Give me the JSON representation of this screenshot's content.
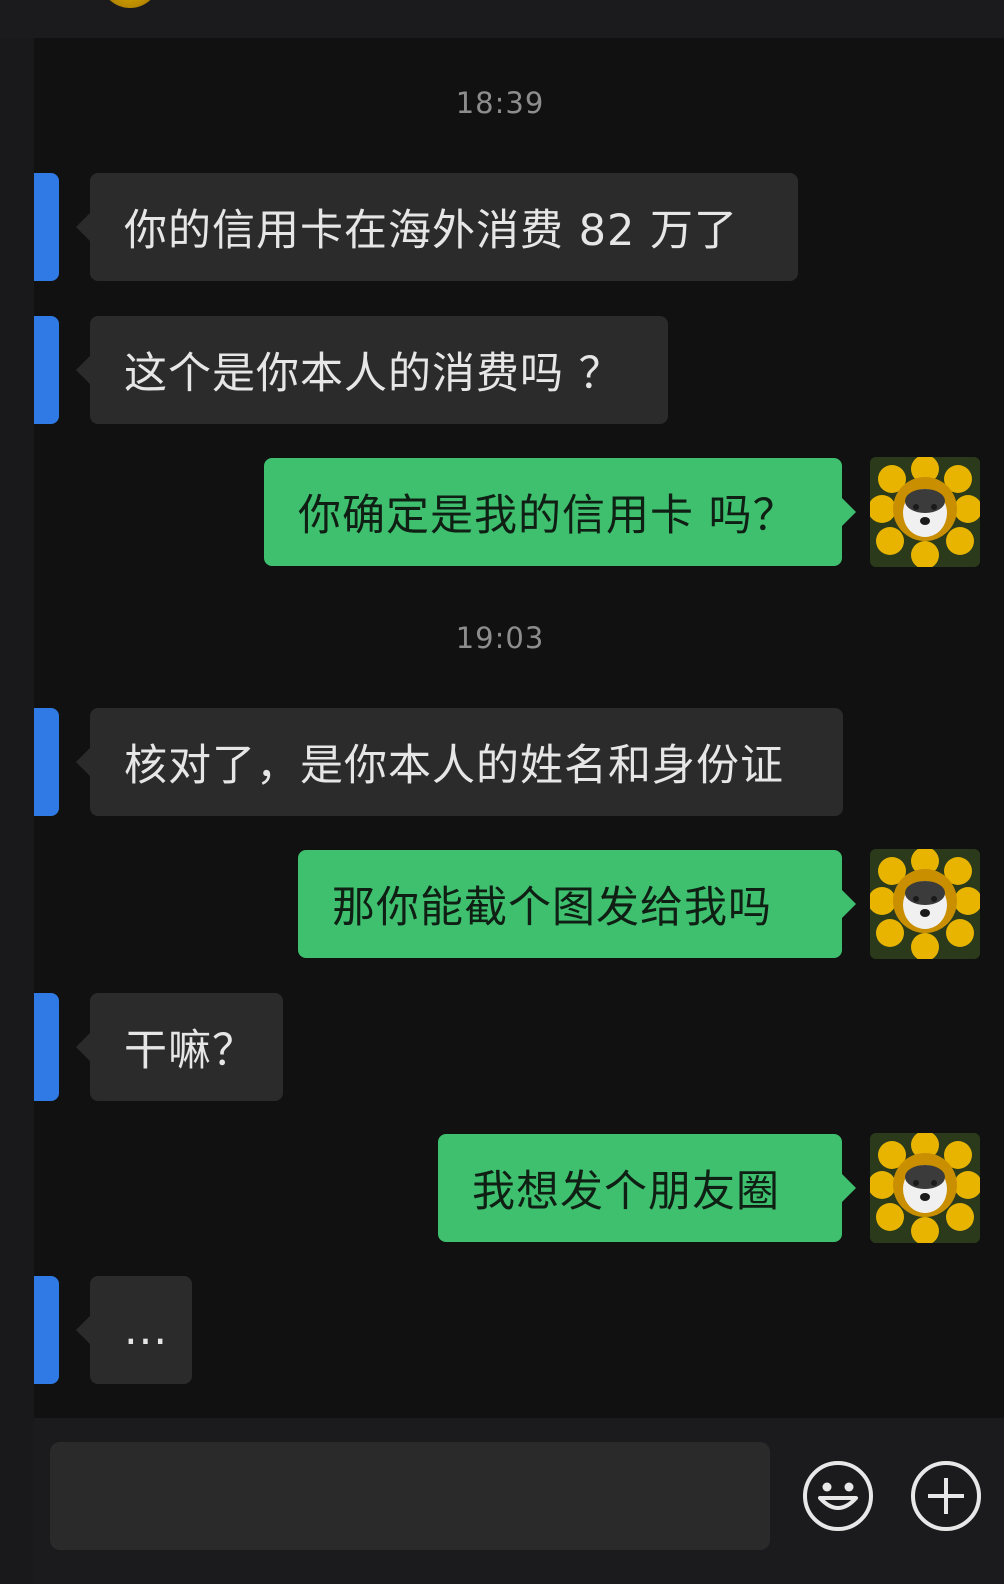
{
  "chat": {
    "timestamps": [
      "18:39",
      "19:03"
    ],
    "messages": [
      {
        "side": "in",
        "text": "你的信用卡在海外消费 82 万了"
      },
      {
        "side": "in",
        "text": "这个是你本人的消费吗 ？"
      },
      {
        "side": "out",
        "text": "你确定是我的信用卡 吗？"
      },
      {
        "side": "in",
        "text": "核对了，是你本人的姓名和身份证"
      },
      {
        "side": "out",
        "text": "那你能截个图发给我吗"
      },
      {
        "side": "in",
        "text": "干嘛？"
      },
      {
        "side": "out",
        "text": "我想发个朋友圈"
      },
      {
        "side": "in",
        "text": "..."
      }
    ]
  },
  "composer": {
    "input_value": "",
    "input_placeholder": ""
  },
  "icons": {
    "emoji": "smiley-face-icon",
    "more": "plus-circle-icon",
    "avatar": "husky-sunflower-avatar"
  },
  "colors": {
    "background": "#111111",
    "incoming_bubble": "#2b2b2b",
    "outgoing_bubble": "#3ec06f",
    "marker": "#2f7ae5",
    "timestamp": "#8d8d8d"
  }
}
